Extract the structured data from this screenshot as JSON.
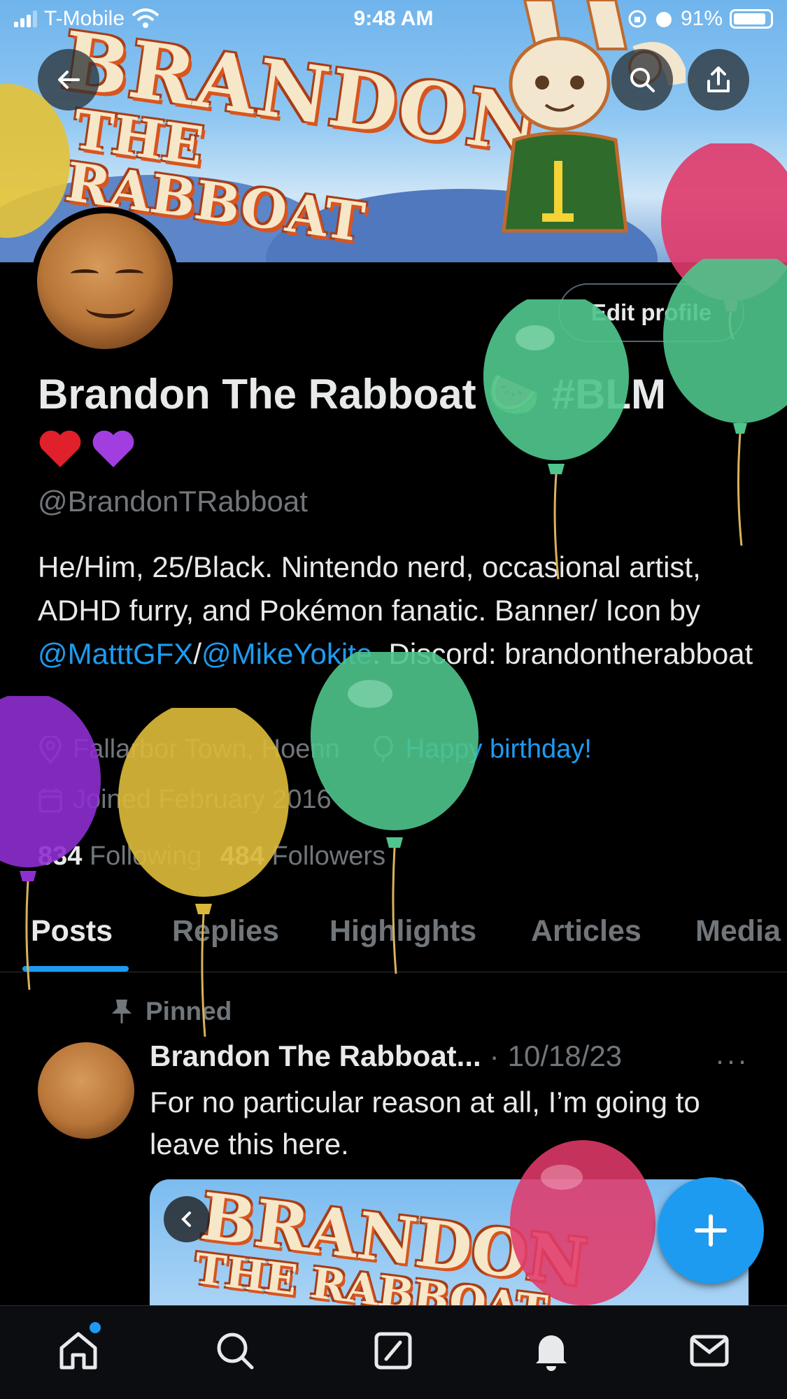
{
  "status_bar": {
    "carrier": "T-Mobile",
    "time": "9:48 AM",
    "battery": "91%"
  },
  "banner": {
    "line1": "BRANDON",
    "line2": "THE RABBOAT"
  },
  "profile": {
    "edit_label": "Edit profile",
    "name": "Brandon The Rabboat 🍉 #BLM",
    "emojis": "❤️💜",
    "handle": "@BrandonTRabboat",
    "bio_part1": "He/Him, 25/Black. Nintendo nerd, occasional artist, ADHD furry, and Pokémon fanatic. Banner/ Icon by ",
    "bio_link1": "@MatttGFX",
    "bio_sep": "/",
    "bio_link2": "@MikeYokite",
    "bio_part2": ". Discord: brandontherabboat",
    "location": "Fallarbor Town, Hoenn",
    "birthday": "Happy birthday!",
    "joined": "Joined February 2016",
    "following_count": "834",
    "following_label": "Following",
    "followers_count": "484",
    "followers_label": "Followers"
  },
  "tabs": [
    "Posts",
    "Replies",
    "Highlights",
    "Articles",
    "Media"
  ],
  "post": {
    "pinned_label": "Pinned",
    "author": "Brandon The Rabboat...",
    "separator": "·",
    "date": "10/18/23",
    "more": "···",
    "text": "For no particular reason at all, I’m going to leave this here.",
    "media_line1": "BRANDON",
    "media_line2": "THE RABBOAT"
  },
  "icons": {
    "back": "arrow-left-icon",
    "search": "search-icon",
    "share": "share-icon",
    "location": "location-pin-icon",
    "balloon": "balloon-icon",
    "calendar": "calendar-icon",
    "pin": "pin-icon",
    "compose": "plus-icon",
    "nav": [
      "home-icon",
      "search-icon",
      "grok-icon",
      "bell-icon",
      "mail-icon"
    ]
  },
  "colors": {
    "accent": "#1d9bf0",
    "muted": "#71767b",
    "text": "#e7e9ea",
    "background": "#000000"
  }
}
